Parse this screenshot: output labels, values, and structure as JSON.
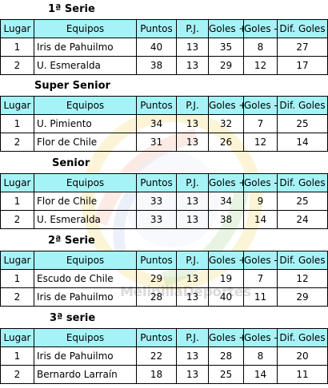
{
  "headers": [
    "Lugar",
    "Equipos",
    "Puntos",
    "P.J.",
    "Goles +",
    "Goles -",
    "Dif. Goles"
  ],
  "watermark": "MelipillaDeportes",
  "sections": [
    {
      "title": "1ª Serie",
      "rows": [
        {
          "place": "1",
          "team": "Iris de Pahuilmo",
          "points": "40",
          "played": "13",
          "gf": "35",
          "ga": "8",
          "diff": "27"
        },
        {
          "place": "2",
          "team": "U. Esmeralda",
          "points": "38",
          "played": "13",
          "gf": "29",
          "ga": "12",
          "diff": "17"
        }
      ]
    },
    {
      "title": "Super Senior",
      "rows": [
        {
          "place": "1",
          "team": "U. Pimiento",
          "points": "34",
          "played": "13",
          "gf": "32",
          "ga": "7",
          "diff": "25"
        },
        {
          "place": "2",
          "team": "Flor de Chile",
          "points": "31",
          "played": "13",
          "gf": "26",
          "ga": "12",
          "diff": "14"
        }
      ]
    },
    {
      "title": "Senior",
      "rows": [
        {
          "place": "1",
          "team": "Flor de Chile",
          "points": "33",
          "played": "13",
          "gf": "34",
          "ga": "9",
          "diff": "25"
        },
        {
          "place": "2",
          "team": "U. Esmeralda",
          "points": "33",
          "played": "13",
          "gf": "38",
          "ga": "14",
          "diff": "24"
        }
      ]
    },
    {
      "title": "2ª Serie",
      "rows": [
        {
          "place": "1",
          "team": "Escudo de Chile",
          "points": "29",
          "played": "13",
          "gf": "19",
          "ga": "7",
          "diff": "12"
        },
        {
          "place": "2",
          "team": "Iris de Pahuilmo",
          "points": "28",
          "played": "13",
          "gf": "40",
          "ga": "11",
          "diff": "29"
        }
      ]
    },
    {
      "title": "3ª serie",
      "rows": [
        {
          "place": "1",
          "team": "Iris de Pahuilmo",
          "points": "22",
          "played": "13",
          "gf": "28",
          "ga": "8",
          "diff": "20"
        },
        {
          "place": "2",
          "team": "Bernardo Larraín",
          "points": "18",
          "played": "13",
          "gf": "25",
          "ga": "14",
          "diff": "11"
        }
      ]
    }
  ]
}
